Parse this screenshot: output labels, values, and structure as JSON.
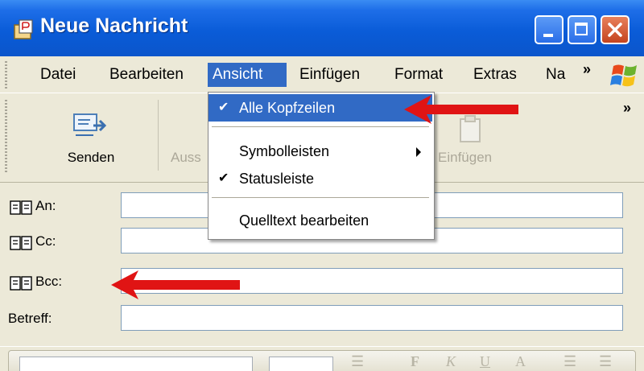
{
  "window": {
    "title": "Neue Nachricht",
    "controls": {
      "minimize": "minimize",
      "maximize": "maximize",
      "close": "close"
    }
  },
  "menubar": {
    "items": [
      {
        "label": "Datei",
        "active": false
      },
      {
        "label": "Bearbeiten",
        "active": false
      },
      {
        "label": "Ansicht",
        "active": true
      },
      {
        "label": "Einfügen",
        "active": false
      },
      {
        "label": "Format",
        "active": false
      },
      {
        "label": "Extras",
        "active": false
      },
      {
        "label": "Na",
        "active": false
      }
    ],
    "overflow": "»"
  },
  "toolbar": {
    "send_label": "Senden",
    "cut_label": "Auss",
    "paste_label": "Einfügen",
    "overflow": "»"
  },
  "view_menu": {
    "items": [
      {
        "label": "Alle Kopfzeilen",
        "checked": true,
        "highlighted": true,
        "submenu": false
      },
      {
        "label": "Symbolleisten",
        "checked": false,
        "highlighted": false,
        "submenu": true
      },
      {
        "label": "Statusleiste",
        "checked": true,
        "highlighted": false,
        "submenu": false
      },
      {
        "label": "Quelltext bearbeiten",
        "checked": false,
        "highlighted": false,
        "submenu": false
      }
    ],
    "check_glyph": "✔"
  },
  "fields": {
    "to_label": "An:",
    "cc_label": "Cc:",
    "bcc_label": "Bcc:",
    "subject_label": "Betreff:",
    "to_value": "",
    "cc_value": "",
    "bcc_value": "",
    "subject_value": ""
  },
  "colors": {
    "title_bar": "#0A5CD8",
    "menu_highlight": "#316AC5",
    "window_face": "#ECE9D8",
    "annotation_arrow": "#E01414"
  }
}
